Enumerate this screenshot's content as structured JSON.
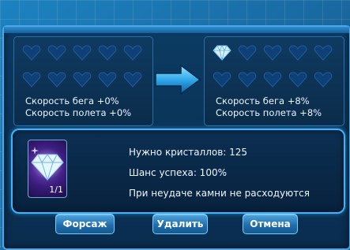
{
  "left_panel": {
    "speed_run": "Скорость бега +0%",
    "speed_fly": "Скорость полета +0%"
  },
  "right_panel": {
    "speed_run": "Скорость бега +8%",
    "speed_fly": "Скорость полета +8%"
  },
  "info": {
    "crystals_needed": "Нужно кристаллов: 125",
    "success_chance": "Шанс успеха: 100%",
    "failure_note": "При неудаче камни не расходуются",
    "crystal_count": "1/1"
  },
  "buttons": {
    "boost": "Форсаж",
    "remove": "Удалить",
    "cancel": "Отмена"
  },
  "icons": {
    "slot": "heart-slot-icon",
    "gem": "diamond-gem-icon",
    "arrow": "right-arrow-icon"
  },
  "colors": {
    "accent": "#3fb3ff",
    "slot_fill": "#0e3f77"
  }
}
